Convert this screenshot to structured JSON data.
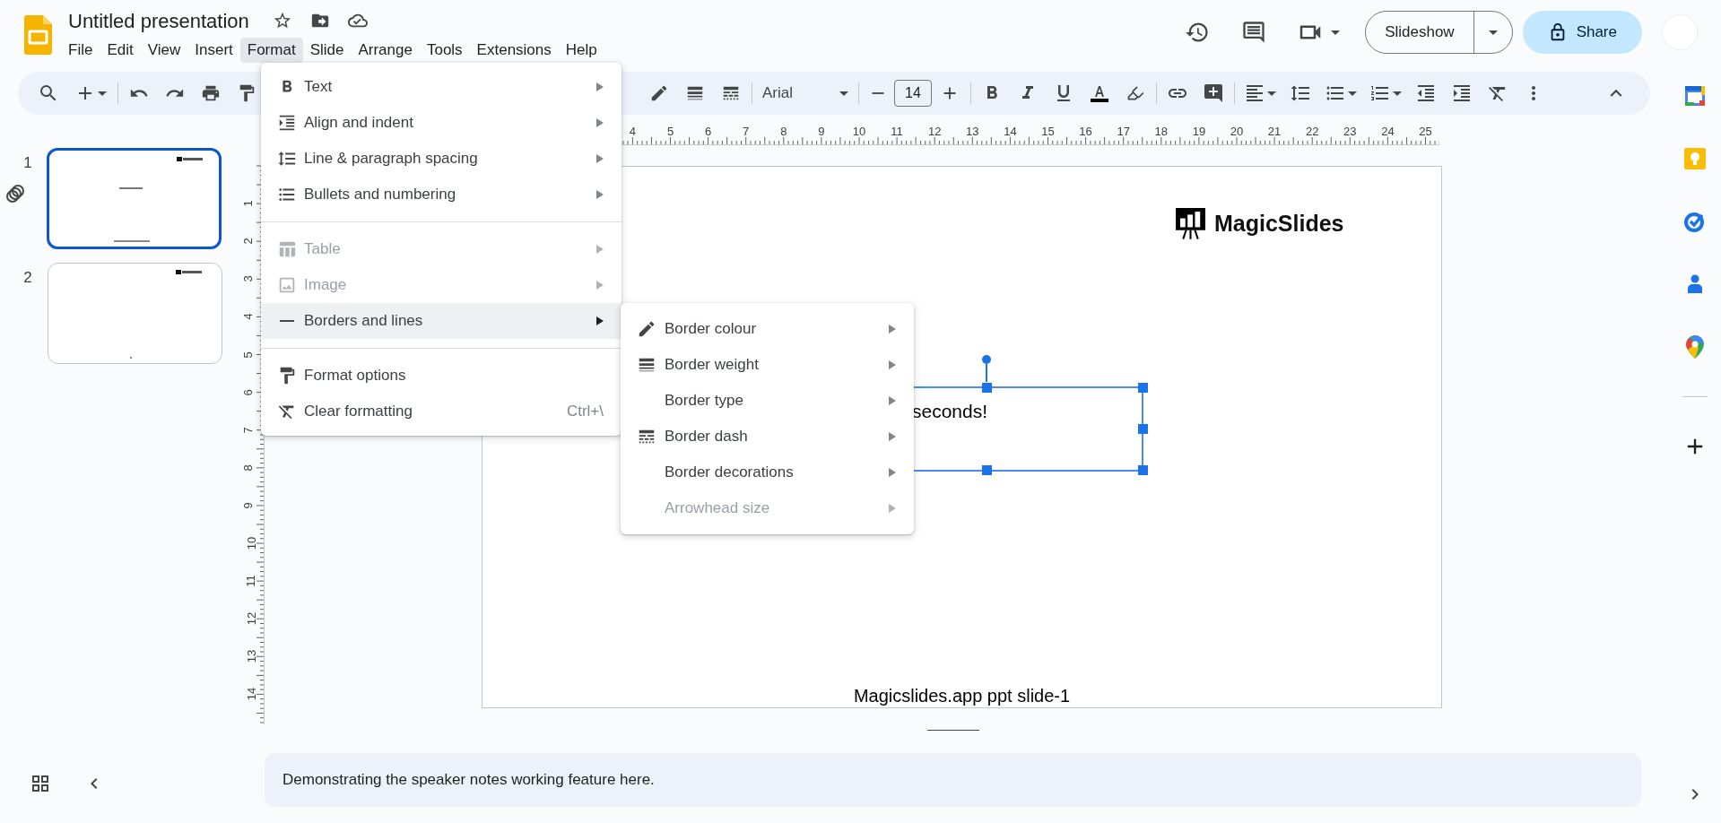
{
  "document": {
    "title": "Untitled presentation"
  },
  "menubar": [
    {
      "label": "File",
      "selected": false
    },
    {
      "label": "Edit",
      "selected": false
    },
    {
      "label": "View",
      "selected": false
    },
    {
      "label": "Insert",
      "selected": false
    },
    {
      "label": "Format",
      "selected": true
    },
    {
      "label": "Slide",
      "selected": false
    },
    {
      "label": "Arrange",
      "selected": false
    },
    {
      "label": "Tools",
      "selected": false
    },
    {
      "label": "Extensions",
      "selected": false
    },
    {
      "label": "Help",
      "selected": false
    }
  ],
  "header": {
    "slideshow_button": "Slideshow",
    "share_button": "Share"
  },
  "toolbar": {
    "font": "Arial",
    "font_size": "14"
  },
  "rulers": {
    "horizontal": [
      "4",
      "5",
      "6",
      "7",
      "8",
      "9",
      "10",
      "11",
      "12",
      "13",
      "14",
      "15",
      "16",
      "17",
      "18",
      "19",
      "20",
      "21",
      "22",
      "23",
      "24",
      "25"
    ],
    "vertical": [
      "1",
      "2",
      "3",
      "4",
      "5",
      "6",
      "7",
      "8",
      "9",
      "10",
      "11",
      "12",
      "13",
      "14"
    ]
  },
  "filmstrip": [
    {
      "number": "1",
      "selected": true,
      "linked": true
    },
    {
      "number": "2",
      "selected": false,
      "linked": false
    }
  ],
  "slide": {
    "logo": "MagicSlides",
    "text_box": "seconds!",
    "text_box_selected": true,
    "footer": "Magicslides.app ppt slide-1"
  },
  "speaker_notes": "Demonstrating the speaker notes working feature here.",
  "format_menu": [
    [
      {
        "label": "Text",
        "disabled": false,
        "selected": false,
        "submenu": true
      },
      {
        "label": "Align and indent",
        "disabled": false,
        "selected": false,
        "submenu": true
      },
      {
        "label": "Line & paragraph spacing",
        "disabled": false,
        "selected": false,
        "submenu": true
      },
      {
        "label": "Bullets and numbering",
        "disabled": false,
        "selected": false,
        "submenu": true
      }
    ],
    [
      {
        "label": "Table",
        "disabled": true,
        "selected": false,
        "submenu": true
      },
      {
        "label": "Image",
        "disabled": true,
        "selected": false,
        "submenu": true
      },
      {
        "label": "Borders and lines",
        "disabled": false,
        "selected": true,
        "submenu": true
      }
    ],
    [
      {
        "label": "Format options",
        "disabled": false,
        "selected": false,
        "submenu": false
      },
      {
        "label": "Clear formatting",
        "disabled": false,
        "selected": false,
        "submenu": false,
        "shortcut": "Ctrl+\\"
      }
    ]
  ],
  "borders_submenu": [
    {
      "label": "Border colour",
      "disabled": false
    },
    {
      "label": "Border weight",
      "disabled": false
    },
    {
      "label": "Border type",
      "disabled": false
    },
    {
      "label": "Border dash",
      "disabled": false
    },
    {
      "label": "Border decorations",
      "disabled": false
    },
    {
      "label": "Arrowhead size",
      "disabled": true
    }
  ]
}
